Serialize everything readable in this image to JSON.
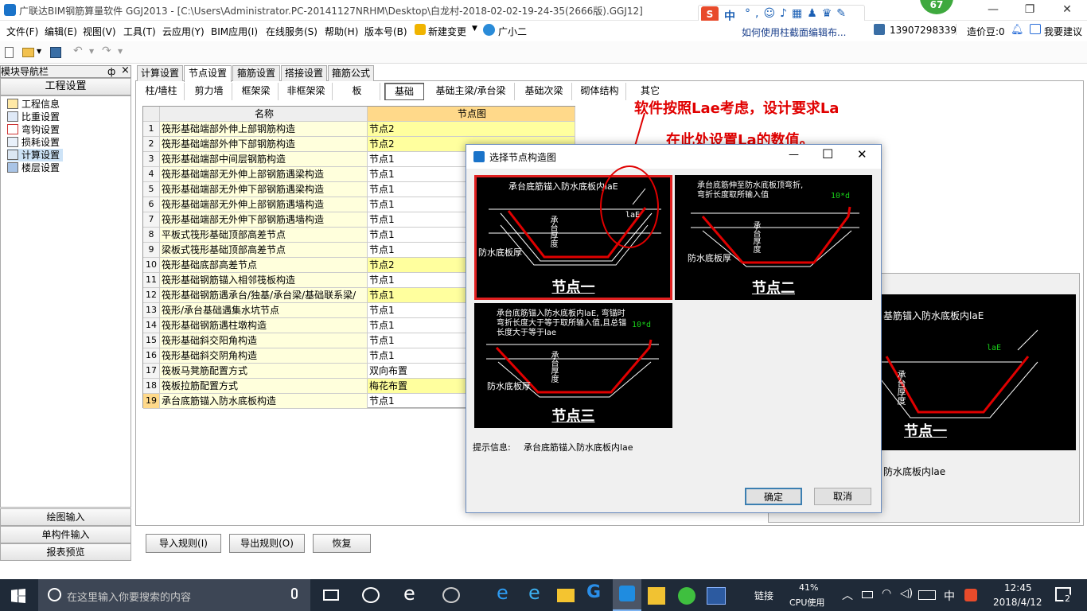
{
  "window": {
    "title": "广联达BIM钢筋算量软件 GGJ2013 - [C:\\Users\\Administrator.PC-20141127NRHM\\Desktop\\白龙村-2018-02-02-19-24-35(2666版).GGJ12]",
    "badge": "67",
    "help_link": "如何使用柱截面编辑布...",
    "ime_label": "中",
    "minimize": "—",
    "maximize": "❐",
    "close": "✕"
  },
  "menu": [
    "文件(F)",
    "编辑(E)",
    "视图(V)",
    "工具(T)",
    "云应用(Y)",
    "BIM应用(I)",
    "在线服务(S)",
    "帮助(H)",
    "版本号(B)",
    "新建变更",
    "广小二"
  ],
  "account": {
    "phone": "13907298339",
    "beans": "造价豆:0",
    "suggest": "我要建议"
  },
  "nav": {
    "title": "模块导航栏",
    "pin": "ф",
    "close": "×",
    "section": "工程设置",
    "items": [
      "工程信息",
      "比重设置",
      "弯钩设置",
      "损耗设置",
      "计算设置",
      "楼层设置"
    ],
    "bottom": [
      "绘图输入",
      "单构件输入",
      "报表预览"
    ]
  },
  "tabs": [
    "计算设置",
    "节点设置",
    "箍筋设置",
    "搭接设置",
    "箍筋公式"
  ],
  "subtabs": [
    "柱/墙柱",
    "剪力墙",
    "框架梁",
    "非框架梁",
    "板",
    "基础",
    "基础主梁/承台梁",
    "基础次梁",
    "砌体结构",
    "其它"
  ],
  "grid": {
    "headers": [
      "名称",
      "节点图"
    ],
    "rows": [
      {
        "no": "1",
        "name": "筏形基础端部外伸上部钢筋构造",
        "value": "节点2",
        "hl": true
      },
      {
        "no": "2",
        "name": "筏形基础端部外伸下部钢筋构造",
        "value": "节点2",
        "hl": true
      },
      {
        "no": "3",
        "name": "筏形基础端部中间层钢筋构造",
        "value": "节点1",
        "hl": false
      },
      {
        "no": "4",
        "name": "筏形基础端部无外伸上部钢筋遇梁构造",
        "value": "节点1",
        "hl": false
      },
      {
        "no": "5",
        "name": "筏形基础端部无外伸下部钢筋遇梁构造",
        "value": "节点1",
        "hl": false
      },
      {
        "no": "6",
        "name": "筏形基础端部无外伸上部钢筋遇墙构造",
        "value": "节点1",
        "hl": false
      },
      {
        "no": "7",
        "name": "筏形基础端部无外伸下部钢筋遇墙构造",
        "value": "节点1",
        "hl": false
      },
      {
        "no": "8",
        "name": "平板式筏形基础顶部高差节点",
        "value": "节点1",
        "hl": false
      },
      {
        "no": "9",
        "name": "梁板式筏形基础顶部高差节点",
        "value": "节点1",
        "hl": false
      },
      {
        "no": "10",
        "name": "筏形基础底部高差节点",
        "value": "节点2",
        "hl": true
      },
      {
        "no": "11",
        "name": "筏形基础钢筋锚入相邻筏板构造",
        "value": "节点1",
        "hl": false
      },
      {
        "no": "12",
        "name": "筏形基础钢筋遇承台/独基/承台梁/基础联系梁/",
        "value": "节点1",
        "hl": true
      },
      {
        "no": "13",
        "name": "筏形/承台基础遇集水坑节点",
        "value": "节点1",
        "hl": false
      },
      {
        "no": "14",
        "name": "筏形基础钢筋遇柱墩构造",
        "value": "节点1",
        "hl": false
      },
      {
        "no": "15",
        "name": "筏形基础斜交阳角构造",
        "value": "节点1",
        "hl": false
      },
      {
        "no": "16",
        "name": "筏形基础斜交阴角构造",
        "value": "节点1",
        "hl": false
      },
      {
        "no": "17",
        "name": "筏板马凳筋配置方式",
        "value": "双向布置",
        "hl": false
      },
      {
        "no": "18",
        "name": "筏板拉筋配置方式",
        "value": "梅花布置",
        "hl": true
      },
      {
        "no": "19",
        "name": "承台底筋锚入防水底板构造",
        "value": "节点1",
        "hl": false
      }
    ]
  },
  "bottom_buttons": [
    "导入规则(I)",
    "导出规则(O)",
    "恢复"
  ],
  "preview": {
    "text": "基筋锚入防水底板内laE",
    "label": "节点一",
    "hint": "防水底板内lae",
    "side_text": "承台厚度",
    "dim": "laE"
  },
  "annotation": {
    "line1": "软件按照Lae考虑，设计要求La",
    "line2": "在此处设置La的数值。"
  },
  "dialog": {
    "title": "选择节点构造图",
    "nodes": [
      {
        "label": "节点一",
        "desc": [
          "承台底筋锚入防水底板内laE"
        ],
        "side": "防水底板厚",
        "thick": "承台厚度",
        "dim": "laE",
        "selected": true
      },
      {
        "label": "节点二",
        "desc": [
          "承台底筋伸至防水底板顶弯折,",
          "弯折长度取所输入值"
        ],
        "side": "防水底板厚",
        "thick": "承台厚度",
        "dim": "10*d",
        "selected": false
      },
      {
        "label": "节点三",
        "desc": [
          "承台底筋锚入防水底板内laE, 弯锚时",
          "弯折长度大于等于取所输入值,且总锚",
          "长度大于等于lae"
        ],
        "side": "防水底板厚",
        "thick": "承台厚度",
        "dim": "10*d",
        "selected": false
      }
    ],
    "hint_label": "提示信息:",
    "hint_text": "承台底筋锚入防水底板内lae",
    "ok": "确定",
    "cancel": "取消",
    "close": "✕",
    "maximize": "☐",
    "minimize": "—"
  },
  "taskbar": {
    "search_placeholder": "在这里输入你要搜索的内容",
    "links": "链接",
    "cpu_pct": "41%",
    "cpu_label": "CPU使用",
    "ime": "中",
    "time": "12:45",
    "date": "2018/4/12",
    "notify": "2"
  },
  "colors": {
    "accent_red": "#e00000",
    "selected_row": "#ffff9e",
    "name_cell": "#ffffdc",
    "taskbar": "#1f2a38"
  }
}
